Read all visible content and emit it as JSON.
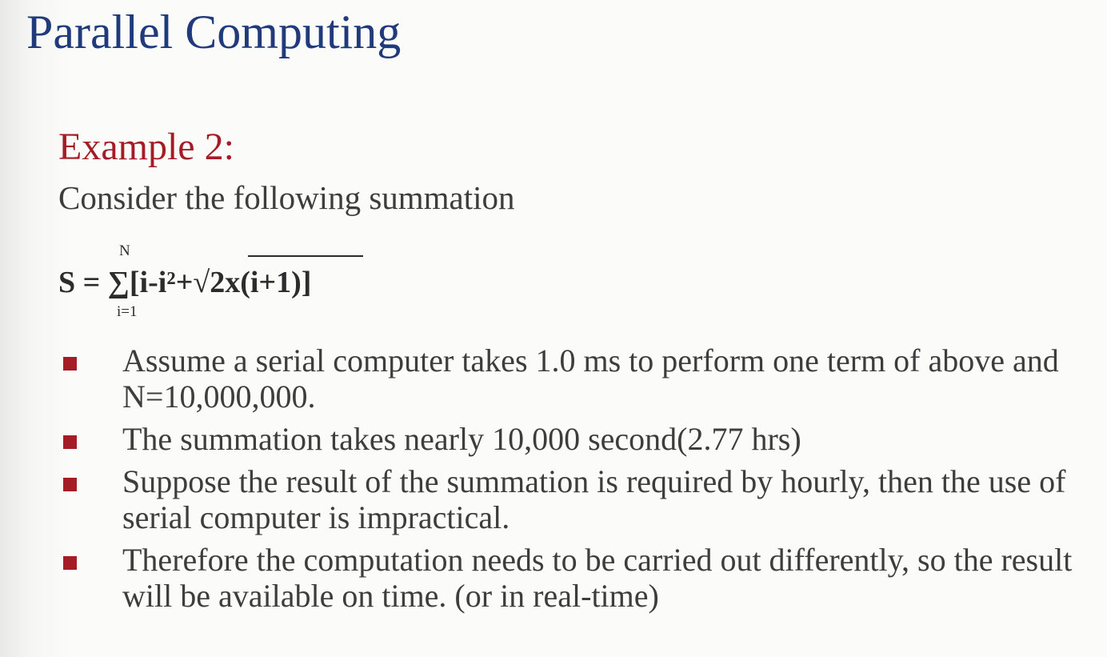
{
  "slide": {
    "title": "Parallel Computing",
    "example_heading": "Example 2:",
    "intro": "Consider the following summation",
    "formula": {
      "main": "S = ∑[i-i²+√2x(i+1)]",
      "upper_limit": "N",
      "lower_limit": "i=1"
    },
    "bullets": [
      {
        "text": "Assume a serial computer takes 1.0 ms to perform one term of above and N=10,000,000."
      },
      {
        "text": "The summation takes nearly 10,000 second(2.77 hrs)"
      },
      {
        "text": "Suppose the result of the summation is required by hourly, then the use of serial computer is impractical."
      },
      {
        "text": "Therefore the computation needs to be carried out differently, so the result will be available on time. (or in real-time)"
      }
    ]
  },
  "colors": {
    "title": "#213a7b",
    "heading": "#a51c26",
    "body_text": "#3d3d3d",
    "bullet_marker": "#a51c26"
  }
}
